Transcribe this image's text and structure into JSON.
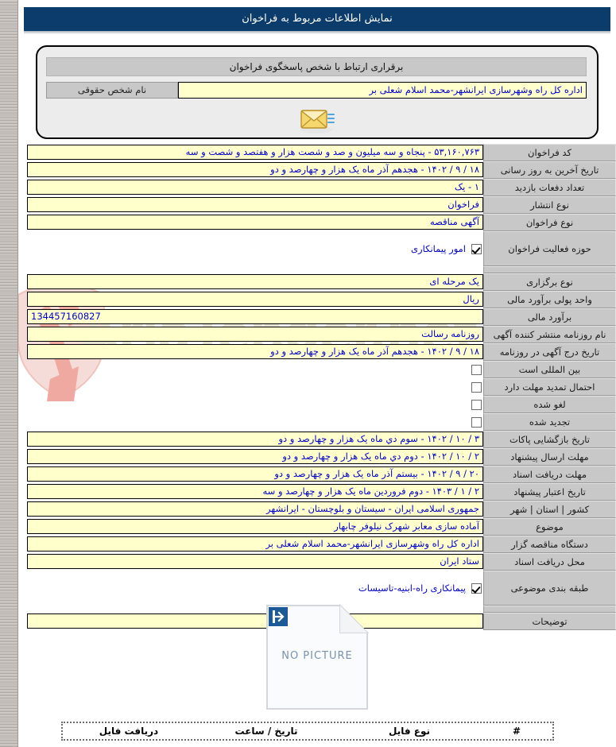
{
  "window": {
    "title": "نمایش اطلاعات مربوط به فراخوان"
  },
  "watermark": {
    "text": "AriaTender.net",
    "logo_icon": "arrow-shield-logo",
    "color": "#e7e3d4"
  },
  "contact_panel": {
    "header": "برقراری ارتباط با شخص پاسخگوی فراخوان",
    "label": "نام شخص حقوقی",
    "value": "اداره کل راه وشهرسازی ایرانشهر-محمد اسلام شعلی بر",
    "mail_icon": "envelope-icon"
  },
  "fields": {
    "code_label": "کد فراخوان",
    "code_value": "۵۳,۱۶۰,۷۶۳ - پنجاه و سه میلیون و صد و شصت هزار و هفتصد و شصت و سه",
    "last_update_label": "تاریخ آخرین به روز رسانی",
    "last_update_value": "۱۸ / ۹ / ۱۴۰۲ - هجدهم آذر ماه یک هزار و چهارصد و دو",
    "visit_count_label": "تعداد دفعات بازدید",
    "visit_count_value": "۱ - یک",
    "publish_type_label": "نوع انتشار",
    "publish_type_value": "فراخوان",
    "call_type_label": "نوع فراخوان",
    "call_type_value": "آگهی مناقصه",
    "activity_label": "حوزه فعالیت فراخوان",
    "activity_value": "امور پیمانکاری",
    "activity_checked": true,
    "holding_type_label": "نوع برگزاری",
    "holding_type_value": "یک مرحله ای",
    "currency_label": "واحد پولی برآورد مالی",
    "currency_value": "ریال",
    "estimate_label": "برآورد مالی",
    "estimate_value": "134457160827",
    "newspaper_label": "نام روزنامه منتشر کننده آگهی",
    "newspaper_value": "روزنامه رسالت",
    "newspaper_date_label": "تاریخ درج آگهی در روزنامه",
    "newspaper_date_value": "۱۸ / ۹ / ۱۴۰۲ - هجدهم آذر ماه یک هزار و چهارصد و دو",
    "international_label": "بین المللی است",
    "international_checked": false,
    "extension_label": "احتمال تمدید مهلت دارد",
    "extension_checked": false,
    "cancelled_label": "لغو شده",
    "cancelled_checked": false,
    "renewed_label": "تجدید شده",
    "renewed_checked": false,
    "opening_label": "تاریخ بازگشایی پاکات",
    "opening_value": "۳ / ۱۰ / ۱۴۰۲ - سوم دي ماه یک هزار و چهارصد و دو",
    "submit_deadline_label": "مهلت ارسال پیشنهاد",
    "submit_deadline_value": "۲ / ۱۰ / ۱۴۰۲ - دوم دي ماه یک هزار و چهارصد و دو",
    "docs_deadline_label": "مهلت دریافت اسناد",
    "docs_deadline_value": "۲۰ / ۹ / ۱۴۰۲ - بیستم آذر ماه یک هزار و چهارصد و دو",
    "validity_label": "تاریخ اعتبار پیشنهاد",
    "validity_value": "۲ / ۱ / ۱۴۰۳ - دوم فروردین ماه یک هزار و چهارصد و سه",
    "location_label": "کشور | استان | شهر",
    "location_value": "جمهوری اسلامی ایران - سیستان و بلوچستان - ایرانشهر",
    "subject_label": "موضوع",
    "subject_value": "آماده سازی معابر شهرک نیلوفر چابهار",
    "organizer_label": "دستگاه مناقصه گزار",
    "organizer_value": "اداره کل راه وشهرسازی ایرانشهر-محمد اسلام شعلی بر",
    "docs_place_label": "محل دریافت اسناد",
    "docs_place_value": "ستاد ایران",
    "classification_label": "طبقه بندی موضوعی",
    "classification_value": "پیمانکاری راه-ابنیه-تاسیسات",
    "classification_checked": true,
    "description_label": "توضیحات",
    "description_value": ""
  },
  "picture": {
    "placeholder_text": "NO PICTURE",
    "icon": "no-picture-icon"
  },
  "file_table": {
    "columns": [
      {
        "key": "num",
        "label": "#"
      },
      {
        "key": "type",
        "label": "نوع فایل"
      },
      {
        "key": "date",
        "label": "تاریخ / ساعت"
      },
      {
        "key": "dl",
        "label": "دریافت فایل"
      }
    ],
    "rows": []
  },
  "colors": {
    "title_bar": "#0c3c6b",
    "label_cell": "#c8c8c8",
    "field_bg": "#ffffcc",
    "field_text": "#0000cc"
  }
}
